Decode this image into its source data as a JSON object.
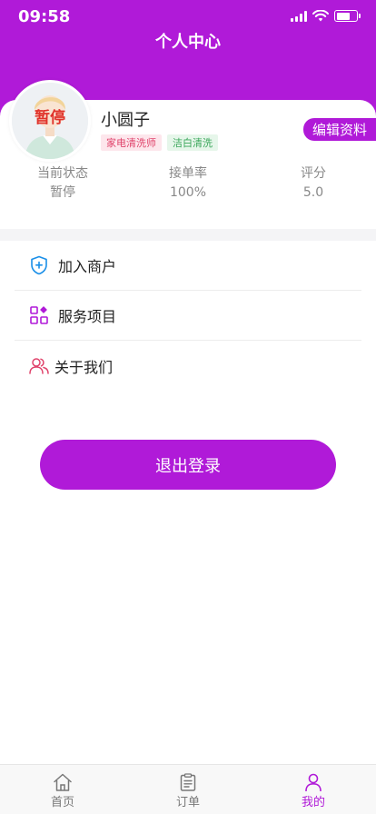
{
  "status_bar": {
    "time": "09:58"
  },
  "nav": {
    "title": "个人中心"
  },
  "profile": {
    "name": "小圆子",
    "avatar_stamp": "暂停",
    "tags": [
      "家电清洗师",
      "洁白清洗"
    ],
    "edit_label": "编辑资料"
  },
  "stats": [
    {
      "label": "当前状态",
      "value": "暂停"
    },
    {
      "label": "接单率",
      "value": "100%"
    },
    {
      "label": "评分",
      "value": "5.0"
    }
  ],
  "menu": [
    {
      "label": "加入商户",
      "icon": "shield-plus-icon"
    },
    {
      "label": "服务项目",
      "icon": "grid-apps-icon"
    },
    {
      "label": "关于我们",
      "icon": "users-icon"
    }
  ],
  "logout_label": "退出登录",
  "tabbar": [
    {
      "label": "首页",
      "icon": "home-icon"
    },
    {
      "label": "订单",
      "icon": "clipboard-icon"
    },
    {
      "label": "我的",
      "icon": "user-icon",
      "active": true
    }
  ],
  "colors": {
    "brand": "#b01ad8",
    "stamp": "#e0332b",
    "tag_pink": "#e0436b",
    "tag_green": "#3aa65a"
  }
}
